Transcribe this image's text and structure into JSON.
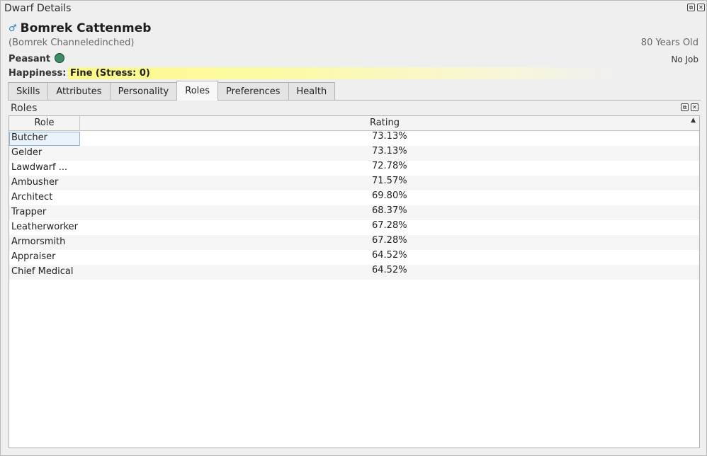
{
  "window": {
    "title": "Dwarf Details"
  },
  "dwarf": {
    "name": "Bomrek Cattenmeb",
    "nickname": "(Bomrek Channeledinched)",
    "age": "80 Years Old",
    "profession": "Peasant",
    "job": "No Job",
    "happiness_label": "Happiness:",
    "happiness_value": "Fine (Stress: 0)"
  },
  "tabs": [
    "Skills",
    "Attributes",
    "Personality",
    "Roles",
    "Preferences",
    "Health"
  ],
  "active_tab": "Roles",
  "panel": {
    "title": "Roles"
  },
  "table": {
    "columns": [
      "Role",
      "Rating"
    ],
    "rows": [
      {
        "role": "Butcher",
        "rating": "73.13%"
      },
      {
        "role": "Gelder",
        "rating": "73.13%"
      },
      {
        "role": "Lawdwarf ...",
        "rating": "72.78%"
      },
      {
        "role": "Ambusher",
        "rating": "71.57%"
      },
      {
        "role": "Architect",
        "rating": "69.80%"
      },
      {
        "role": "Trapper",
        "rating": "68.37%"
      },
      {
        "role": "Leatherworker",
        "rating": "67.28%"
      },
      {
        "role": "Armorsmith",
        "rating": "67.28%"
      },
      {
        "role": "Appraiser",
        "rating": "64.52%"
      },
      {
        "role": "Chief Medical",
        "rating": "64.52%"
      }
    ]
  },
  "icons": {
    "gender": "male-symbol-icon",
    "profession": "peasant-circle-icon",
    "sort": "sort-descending-icon"
  },
  "colors": {
    "happiness_bar": "#fbf98a",
    "profession_icon": "#3c8c66",
    "gender_icon": "#2a7fd4"
  }
}
